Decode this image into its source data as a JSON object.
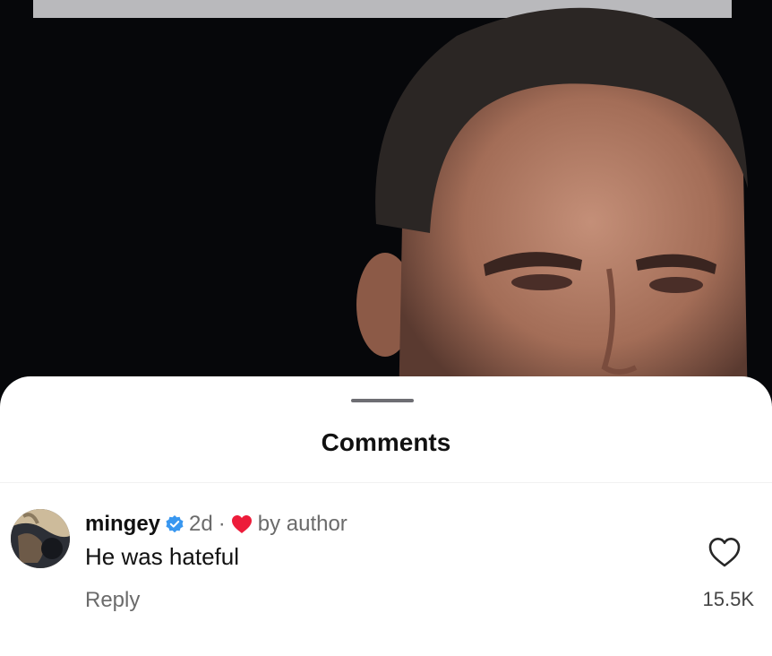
{
  "sheet": {
    "title": "Comments"
  },
  "comment": {
    "username": "mingey",
    "verified": true,
    "age": "2d",
    "separator": "·",
    "liked_by_author_label": "by author",
    "text": "He was hateful",
    "reply_label": "Reply",
    "like_count": "15.5K"
  },
  "icons": {
    "verified": "verified-badge-icon",
    "author_heart": "heart-filled-icon",
    "like": "heart-outline-icon"
  },
  "colors": {
    "verified_blue": "#3897f0",
    "heart_red": "#ed1c3a"
  }
}
